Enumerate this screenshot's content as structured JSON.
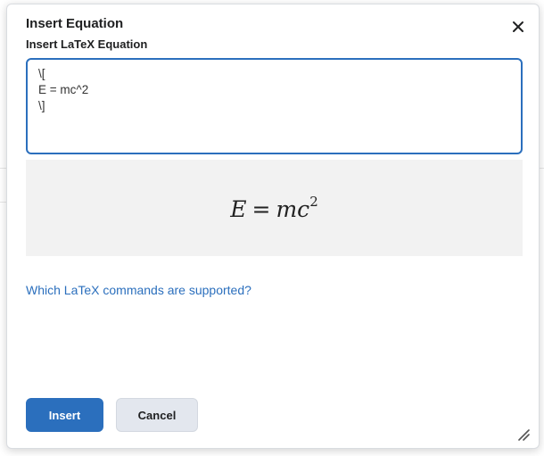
{
  "dialog": {
    "title": "Insert Equation",
    "close_icon": "close-icon",
    "field_label": "Insert LaTeX Equation",
    "latex_value": "\\[\nE = mc^2\n\\]",
    "preview": {
      "lhs": "E",
      "op": "=",
      "rhs_base": "mc",
      "rhs_exp": "2"
    },
    "help_link": "Which LaTeX commands are supported?",
    "insert_label": "Insert",
    "cancel_label": "Cancel",
    "resize_icon": "resize-handle-icon"
  },
  "colors": {
    "accent": "#2b6fbd",
    "preview_bg": "#f2f2f2",
    "secondary_button": "#e3e7ee"
  }
}
